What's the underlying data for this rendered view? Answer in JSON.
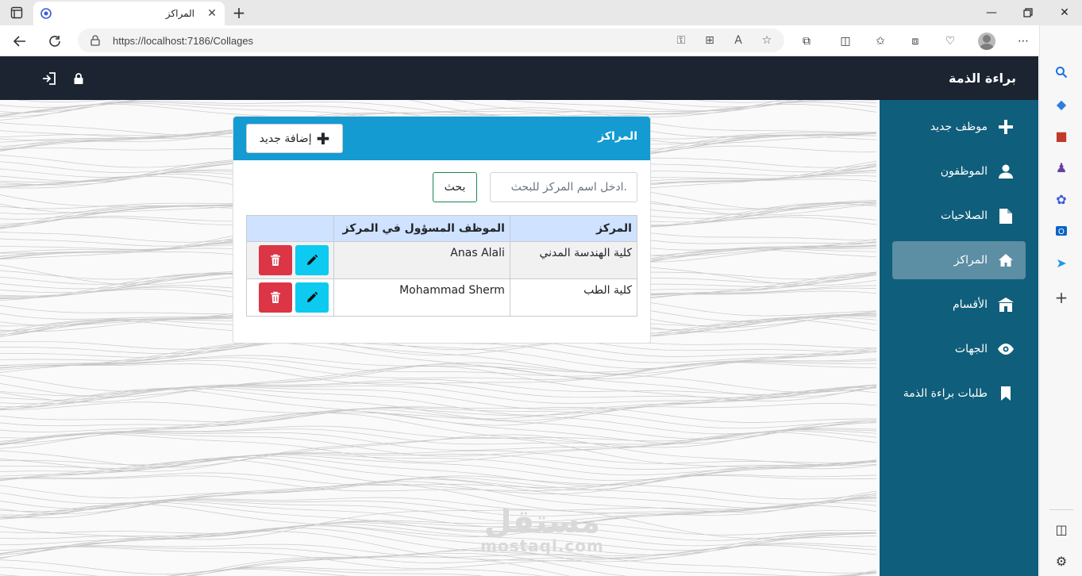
{
  "browser": {
    "tab_title": "المراكز",
    "url": "https://localhost:7186/Collages"
  },
  "app": {
    "brand": "براءة الذمة"
  },
  "sidebar": {
    "items": [
      {
        "label": "موظف جديد",
        "icon": "plus-icon",
        "active": false
      },
      {
        "label": "الموظفون",
        "icon": "user-icon",
        "active": false
      },
      {
        "label": "الصلاحيات",
        "icon": "file-icon",
        "active": false
      },
      {
        "label": "المراكز",
        "icon": "home-icon",
        "active": true
      },
      {
        "label": "الأقسام",
        "icon": "building-icon",
        "active": false
      },
      {
        "label": "الجهات",
        "icon": "eye-icon",
        "active": false
      },
      {
        "label": "طلبات براءة الذمة",
        "icon": "bookmark-icon",
        "active": false
      }
    ]
  },
  "card": {
    "title": "المراكز",
    "add_label": "إضافة جديد",
    "search_placeholder": "ادخل اسم المركز للبحث.",
    "search_label": "بحث"
  },
  "table": {
    "headers": [
      "المركز",
      "الموظف المسؤول في المركز",
      ""
    ],
    "rows": [
      {
        "center": "كلية الهندسة المدني",
        "employee": "Anas Alali"
      },
      {
        "center": "كلية الطب",
        "employee": "Mohammad Sherm"
      }
    ]
  },
  "watermark": {
    "logo": "مستقل",
    "domain": "mostaql.com"
  },
  "colors": {
    "topbar": "#1c2431",
    "sidebar": "#0f5e7b",
    "card_header": "#139bd2",
    "delete": "#dc3545",
    "edit": "#0dcaf0",
    "search_border": "#198754"
  }
}
